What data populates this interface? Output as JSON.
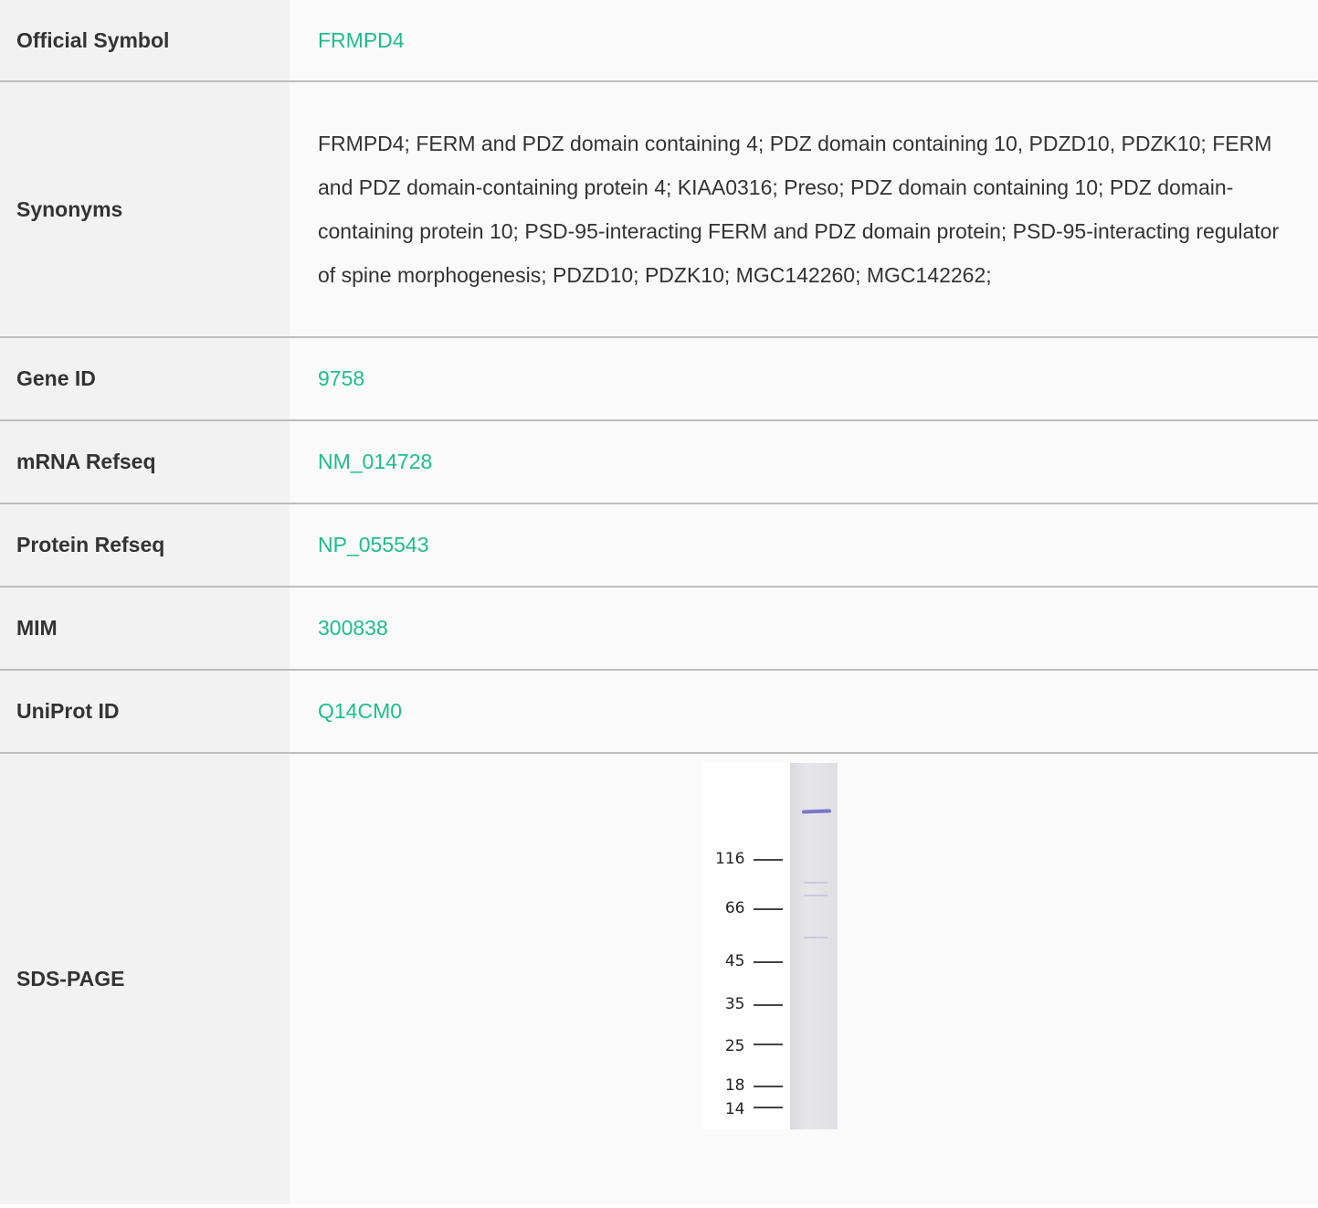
{
  "rows": {
    "symbol": {
      "label": "Official Symbol",
      "value": "FRMPD4"
    },
    "synonyms": {
      "label": "Synonyms",
      "value": "FRMPD4; FERM and PDZ domain containing 4; PDZ domain containing 10, PDZD10, PDZK10; FERM and PDZ domain-containing protein 4; KIAA0316; Preso; PDZ domain containing 10; PDZ domain-containing protein 10; PSD-95-interacting FERM and PDZ domain protein; PSD-95-interacting regulator of spine morphogenesis; PDZD10; PDZK10; MGC142260; MGC142262;"
    },
    "gene_id": {
      "label": "Gene ID",
      "value": "9758"
    },
    "mrna": {
      "label": "mRNA Refseq",
      "value": "NM_014728"
    },
    "protein": {
      "label": "Protein Refseq",
      "value": "NP_055543"
    },
    "mim": {
      "label": "MIM",
      "value": "300838"
    },
    "uniprot": {
      "label": "UniProt ID",
      "value": "Q14CM0"
    },
    "sds": {
      "label": "SDS-PAGE",
      "markers": [
        "116",
        "66",
        "45",
        "35",
        "25",
        "18",
        "14"
      ]
    }
  },
  "colors": {
    "link": "#1ebd8e",
    "label_bg": "#f2f2f2",
    "value_bg": "#fafafa",
    "band": "#7a78c8"
  }
}
